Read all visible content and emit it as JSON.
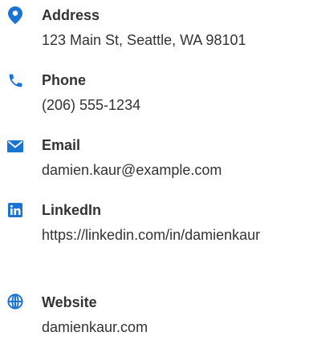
{
  "accent_color": "#1b73d3",
  "contacts": [
    {
      "icon": "map-pin-icon",
      "label": "Address",
      "value": "123 Main St, Seattle, WA 98101"
    },
    {
      "icon": "phone-icon",
      "label": "Phone",
      "value": "(206) 555-1234"
    },
    {
      "icon": "envelope-icon",
      "label": "Email",
      "value": "damien.kaur@example.com"
    },
    {
      "icon": "linkedin-icon",
      "label": "LinkedIn",
      "value": "https://linkedin.com/in/damienkaur"
    },
    {
      "icon": "globe-icon",
      "label": "Website",
      "value": "damienkaur.com"
    }
  ]
}
